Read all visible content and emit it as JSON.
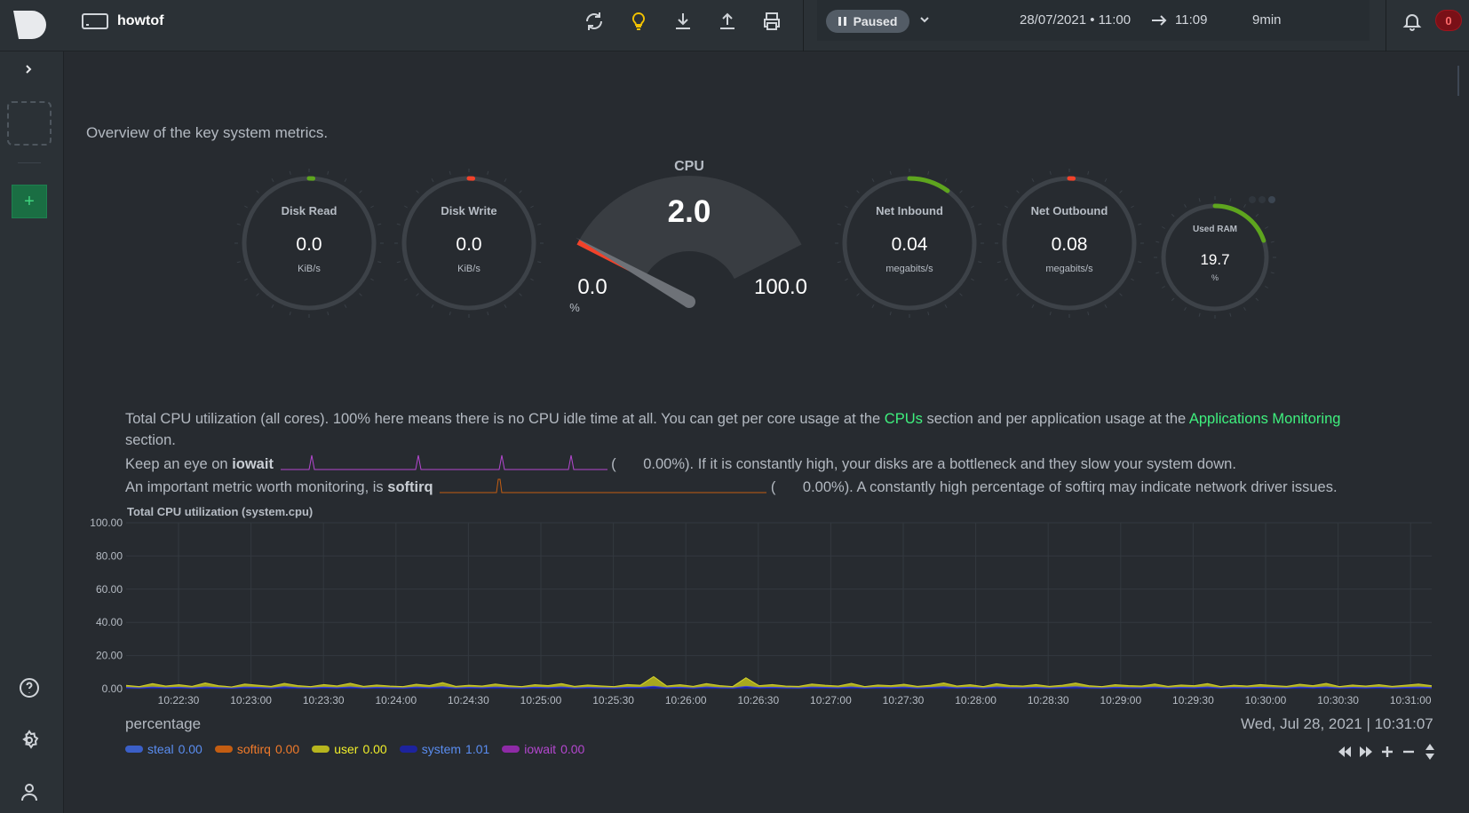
{
  "topbar": {
    "space_name": "howtof",
    "icons": [
      "reload-icon",
      "theme-bulb-icon",
      "download-icon",
      "upload-icon",
      "print-icon"
    ],
    "player": {
      "state_label": "Paused",
      "start": "28/07/2021 • 11:00",
      "end": "11:09",
      "duration": "9min"
    },
    "notifications_count": "0"
  },
  "sidebar": {
    "add_label": "+",
    "icons": [
      "help-icon",
      "settings-icon",
      "user-icon"
    ]
  },
  "main": {
    "overview_text": "Overview of the key system metrics."
  },
  "gauges": {
    "disk_read": {
      "label": "Disk Read",
      "value": "0.0",
      "unit": "KiB/s",
      "fill": 0.01
    },
    "disk_write": {
      "label": "Disk Write",
      "value": "0.0",
      "unit": "KiB/s",
      "fill": 0.01
    },
    "cpu": {
      "label": "CPU",
      "value": "2.0",
      "min": "0.0",
      "max": "100.0",
      "unit": "%",
      "fill": 0.02
    },
    "net_inbound": {
      "label": "Net Inbound",
      "value": "0.04",
      "unit": "megabits/s",
      "fill": 0.1
    },
    "net_outbound": {
      "label": "Net Outbound",
      "value": "0.08",
      "unit": "megabits/s",
      "fill": 0.01
    },
    "used_ram": {
      "label": "Used RAM",
      "value": "19.7",
      "unit": "%",
      "fill": 0.197
    }
  },
  "description": {
    "line1_a": "Total CPU utilization (all cores). 100% here means there is no CPU idle time at all. You can get per core usage at the ",
    "cpus_link": "CPUs",
    "line1_b": " section and per application usage at the ",
    "apps_link": "Applications Monitoring",
    "line1_c": "section.",
    "iowait_prefix": "Keep an eye on ",
    "iowait_word": "iowait",
    "iowait_paren_open": "(",
    "iowait_value": "0.00%).",
    "iowait_suffix": " If it is constantly high, your disks are a bottleneck and they slow your system down.",
    "softirq_prefix": "An important metric worth monitoring, is ",
    "softirq_word": "softirq",
    "softirq_paren_open": "(",
    "softirq_value": "0.00%).",
    "softirq_suffix": " A constantly high percentage of softirq may indicate network driver issues."
  },
  "chart_data": {
    "type": "area",
    "title": "Total CPU utilization (system.cpu)",
    "ylabel": "percentage",
    "ylim": [
      0,
      100
    ],
    "y_ticks": [
      "100.00",
      "80.00",
      "60.00",
      "40.00",
      "20.00",
      "0.00"
    ],
    "x_ticks": [
      "10:22:30",
      "10:23:00",
      "10:23:30",
      "10:24:00",
      "10:24:30",
      "10:25:00",
      "10:25:30",
      "10:26:00",
      "10:26:30",
      "10:27:00",
      "10:27:30",
      "10:28:00",
      "10:28:30",
      "10:29:00",
      "10:29:30",
      "10:30:00",
      "10:30:30",
      "10:31:00"
    ],
    "date_label": "Wed, Jul 28, 2021 | 10:31:07",
    "grid": true,
    "series": [
      {
        "name": "steal",
        "value": "0.00",
        "color": "#3b5fc7",
        "text_color": "#5a8df0"
      },
      {
        "name": "softirq",
        "value": "0.00",
        "color": "#c35d12",
        "text_color": "#f07a2a"
      },
      {
        "name": "user",
        "value": "0.00",
        "color": "#b7b51e",
        "text_color": "#f0ee2a"
      },
      {
        "name": "system",
        "value": "1.01",
        "color": "#1d239e",
        "text_color": "#5a8df0"
      },
      {
        "name": "iowait",
        "value": "0.00",
        "color": "#8e2aa6",
        "text_color": "#b447cf"
      }
    ],
    "user_values": [
      1.2,
      0.8,
      2.1,
      1.0,
      1.5,
      0.9,
      2.4,
      1.1,
      0.7,
      1.8,
      1.3,
      0.9,
      2.0,
      1.2,
      0.8,
      1.6,
      1.1,
      2.2,
      0.9,
      1.4,
      1.0,
      0.8,
      1.7,
      1.2,
      2.5,
      0.9,
      1.3,
      1.0,
      1.8,
      1.1,
      0.8,
      1.5,
      1.2,
      2.0,
      0.9,
      1.4,
      1.1,
      0.8,
      1.6,
      1.3,
      5.8,
      1.0,
      1.5,
      0.9,
      2.0,
      1.2,
      0.8,
      5.2,
      1.1,
      1.6,
      1.0,
      0.9,
      1.8,
      1.3,
      1.0,
      2.1,
      0.8,
      1.4,
      1.1,
      1.7,
      0.9,
      1.3,
      2.3,
      1.0,
      1.5,
      0.8,
      1.9,
      1.2,
      1.0,
      1.6,
      0.9,
      1.3,
      2.2,
      1.1,
      0.8,
      1.5,
      1.2,
      1.0,
      1.8,
      0.9,
      1.4,
      1.1,
      2.0,
      0.8,
      1.3,
      1.0,
      1.6,
      1.2,
      0.9,
      1.7,
      1.1,
      2.1,
      0.8,
      1.4,
      1.0,
      1.5,
      0.9,
      1.3,
      1.8,
      1.1
    ],
    "system_values": [
      0.8,
      0.5,
      1.0,
      0.6,
      0.9,
      0.5,
      1.1,
      0.7,
      0.4,
      1.0,
      0.8,
      0.5,
      1.2,
      0.7,
      0.5,
      0.9,
      0.6,
      1.1,
      0.5,
      0.8,
      0.6,
      0.5,
      1.0,
      0.7,
      1.2,
      0.5,
      0.8,
      0.6,
      1.0,
      0.7,
      0.5,
      0.9,
      0.7,
      1.1,
      0.5,
      0.8,
      0.6,
      0.5,
      0.9,
      0.8,
      1.5,
      0.6,
      0.9,
      0.5,
      1.1,
      0.7,
      0.5,
      1.4,
      0.7,
      0.9,
      0.6,
      0.5,
      1.0,
      0.8,
      0.6,
      1.1,
      0.5,
      0.8,
      0.7,
      1.0,
      0.5,
      0.8,
      1.2,
      0.6,
      0.9,
      0.5,
      1.1,
      0.7,
      0.6,
      0.9,
      0.5,
      0.8,
      1.2,
      0.7,
      0.5,
      0.9,
      0.7,
      0.6,
      1.0,
      0.5,
      0.8,
      0.7,
      1.1,
      0.5,
      0.8,
      0.6,
      0.9,
      0.7,
      0.5,
      1.0,
      0.7,
      1.1,
      0.5,
      0.8,
      0.6,
      0.9,
      0.5,
      0.8,
      1.0,
      0.7
    ]
  },
  "controls": [
    "rewind-icon",
    "forward-icon",
    "zoom-in-icon",
    "zoom-out-icon",
    "resize-icon"
  ]
}
